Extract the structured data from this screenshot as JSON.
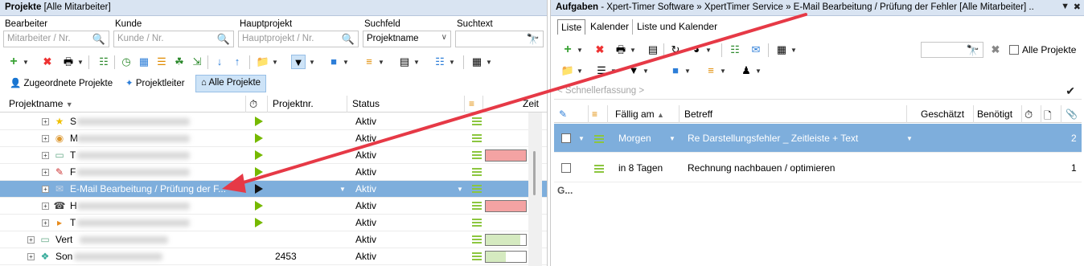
{
  "left": {
    "title": "Projekte",
    "title_suffix": "[Alle Mitarbeiter]",
    "filters": {
      "bearbeiter_label": "Bearbeiter",
      "bearbeiter_placeholder": "Mitarbeiter / Nr.",
      "kunde_label": "Kunde",
      "kunde_placeholder": "Kunde / Nr.",
      "hauptprojekt_label": "Hauptprojekt",
      "hauptprojekt_placeholder": "Hauptprojekt / Nr.",
      "suchfeld_label": "Suchfeld",
      "suchfeld_value": "Projektname",
      "suchtext_label": "Suchtext"
    },
    "viewtabs": [
      "Zugeordnete Projekte",
      "Projektleiter",
      "Alle Projekte"
    ],
    "columns": {
      "name": "Projektname",
      "nr": "Projektnr.",
      "status": "Status",
      "zeit": "Zeit"
    },
    "rows": [
      {
        "label": "S",
        "blurred": true,
        "icon": "star-icon",
        "nr": "",
        "status": "Aktiv",
        "progress": null,
        "color": null,
        "selected": false
      },
      {
        "label": "M",
        "blurred": true,
        "icon": "palette-icon",
        "nr": "",
        "status": "Aktiv",
        "progress": null,
        "color": null,
        "selected": false
      },
      {
        "label": "T",
        "blurred": true,
        "icon": "cash-icon",
        "nr": "",
        "status": "Aktiv",
        "progress": 1.0,
        "color": "#f4a3a3",
        "selected": false
      },
      {
        "label": "F",
        "blurred": true,
        "icon": "form-icon",
        "nr": "",
        "status": "Aktiv",
        "progress": null,
        "color": null,
        "selected": false
      },
      {
        "label": "E-Mail Bearbeitung / Prüfung der F...",
        "blurred": false,
        "icon": "email-icon",
        "nr": "",
        "status": "Aktiv",
        "progress": null,
        "color": null,
        "selected": true
      },
      {
        "label": "H",
        "blurred": true,
        "icon": "headset-icon",
        "nr": "",
        "status": "Aktiv",
        "progress": 1.0,
        "color": "#f4a3a3",
        "selected": false
      },
      {
        "label": "T",
        "blurred": true,
        "icon": "tag-icon",
        "nr": "",
        "status": "Aktiv",
        "progress": null,
        "color": null,
        "selected": false
      },
      {
        "label": "Vert",
        "blurred": true,
        "icon": "cash-icon",
        "nr": "",
        "status": "Aktiv",
        "progress": 0.85,
        "color": "#d5eac0",
        "selected": false
      },
      {
        "label": "Son",
        "blurred": true,
        "icon": "puzzle-icon",
        "nr": "2453",
        "status": "Aktiv",
        "progress": 0.5,
        "color": "#d5eac0",
        "selected": false
      }
    ]
  },
  "right": {
    "title": "Aufgaben",
    "title_suffix": "- Xpert-Timer Software » XpertTimer Service » E-Mail Bearbeitung / Prüfung der Fehler [Alle Mitarbeiter] ..",
    "tabs": [
      "Liste",
      "Kalender",
      "Liste und Kalender"
    ],
    "alle_projekte": "Alle Projekte",
    "quick_placeholder": "< Schnellerfassung >",
    "columns": {
      "faellig": "Fällig am",
      "betreff": "Betreff",
      "geschaetzt": "Geschätzt",
      "benoetigt": "Benötigt"
    },
    "rows": [
      {
        "faellig": "Morgen",
        "betreff": "Re Darstellungsfehler _ Zeitleiste + Text",
        "count": "2",
        "selected": true
      },
      {
        "faellig": "in 8 Tagen",
        "betreff": "Rechnung nachbauen / optimieren",
        "count": "1",
        "selected": false
      }
    ],
    "group_label": "G..."
  },
  "colors": {
    "selection": "#7eaedc",
    "accent": "#e63946",
    "play": "#76b900"
  }
}
